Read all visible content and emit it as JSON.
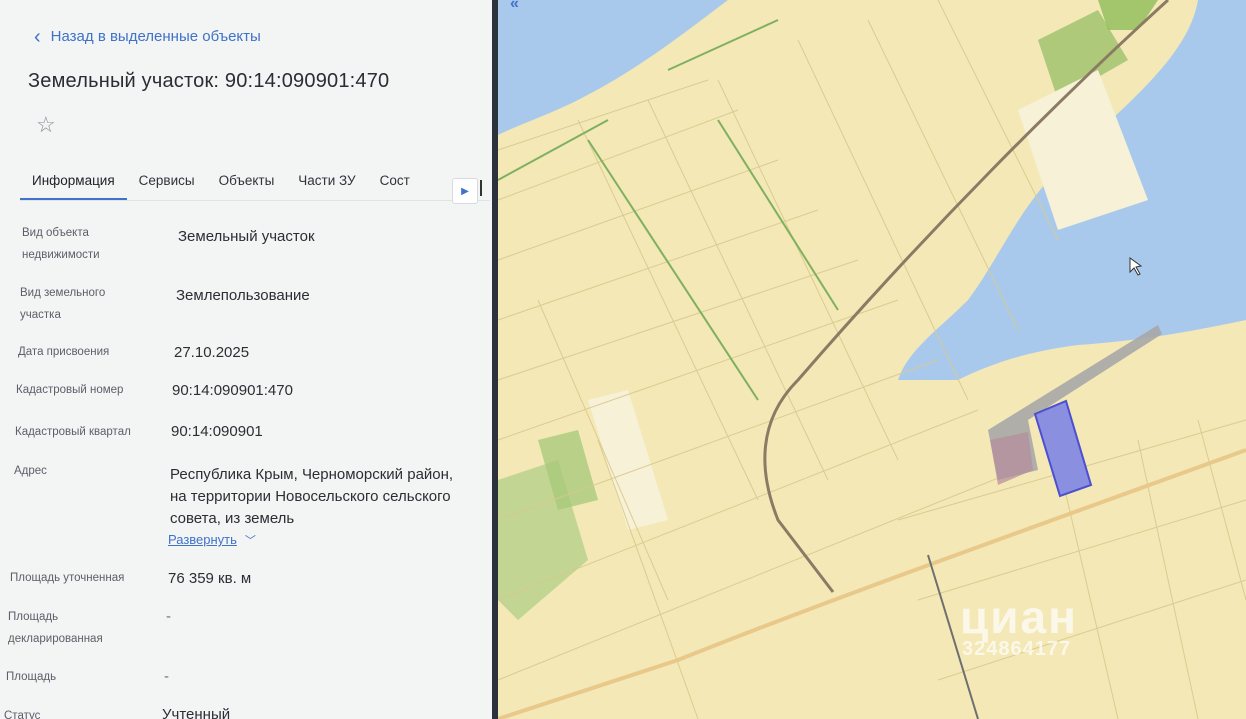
{
  "panel": {
    "back_label": "Назад в выделенные объекты",
    "title": "Земельный участок: 90:14:090901:470",
    "tabs": [
      "Информация",
      "Сервисы",
      "Объекты",
      "Части ЗУ",
      "Соста"
    ],
    "fields": [
      {
        "label": "Вид объекта недвижимости",
        "value": "Земельный участок"
      },
      {
        "label": "Вид земельного участка",
        "value": "Землепользование"
      },
      {
        "label": "Дата присвоения",
        "value": "27.10.2025"
      },
      {
        "label": "Кадастровый номер",
        "value": "90:14:090901:470"
      },
      {
        "label": "Кадастровый квартал",
        "value": "90:14:090901"
      },
      {
        "label": "Адрес",
        "value": "Республика Крым, Черноморский район, на территории Новосельского сельского совета, из земель"
      },
      {
        "label": "Площадь уточненная",
        "value": "76 359 кв. м"
      },
      {
        "label": "Площадь декларированная",
        "value": "-"
      },
      {
        "label": "Площадь",
        "value": "-"
      },
      {
        "label": "Статус",
        "value": "Учтенный"
      }
    ],
    "expand_label": "Развернуть"
  },
  "map": {
    "colors": {
      "land": "#f3e8b6",
      "water": "#a9c9ec",
      "parcel": "#8a8fe0",
      "road": "#8c7b64"
    },
    "watermark": "циан",
    "watermark_id": "324864177"
  }
}
